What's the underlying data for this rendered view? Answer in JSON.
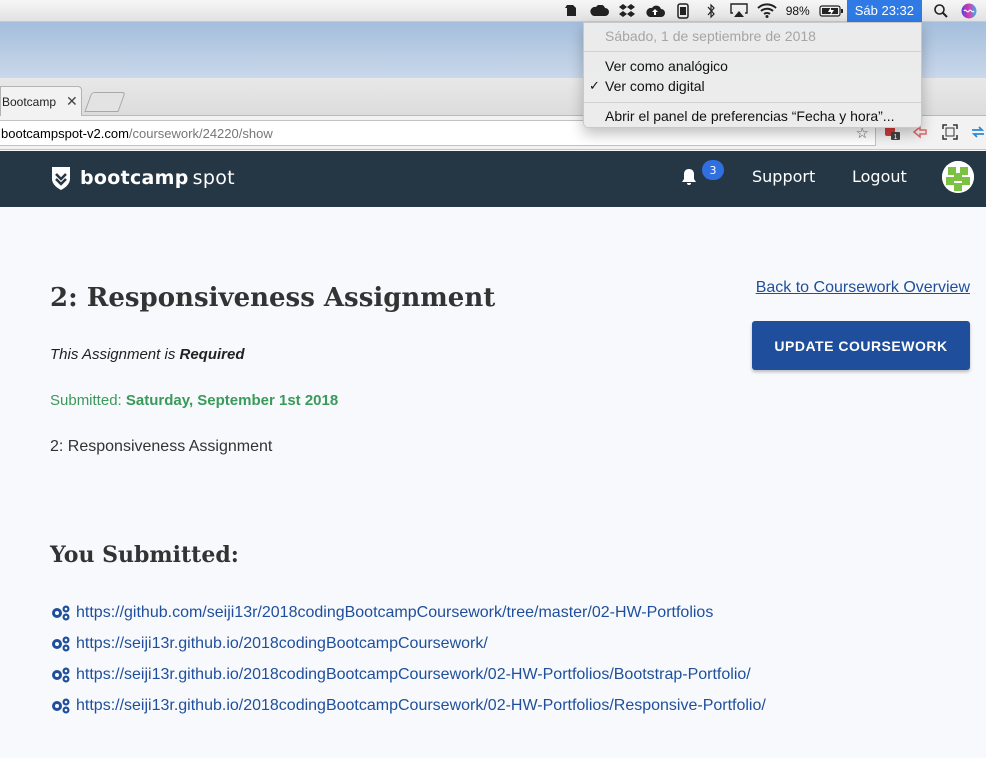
{
  "menubar": {
    "battery": "98%",
    "clock": "Sáb 23:32",
    "icons": [
      "evernote-icon",
      "cloud-icon",
      "dropbox-icon",
      "cloud-upload-icon",
      "phone-icon",
      "bluetooth-icon",
      "airplay-icon",
      "wifi-icon",
      "battery-icon",
      "spotlight-icon",
      "siri-icon"
    ]
  },
  "clock_menu": {
    "date": "Sábado, 1 de septiembre de 2018",
    "analog": "Ver como analógico",
    "digital": "Ver como digital",
    "check": "✓",
    "prefs": "Abrir el panel de preferencias “Fecha y hora”..."
  },
  "browser": {
    "tab_title": "Bootcamp",
    "tab_close": "✕",
    "url_host": "bootcampspot-v2.com",
    "url_path": "/coursework/24220/show",
    "star": "☆",
    "ext_badge": "1"
  },
  "site": {
    "logo_bold": "bootcamp",
    "logo_light": "spot",
    "notifications": "3",
    "support": "Support",
    "logout": "Logout"
  },
  "page": {
    "title": "2: Responsiveness Assignment",
    "required_prefix": "This Assignment is ",
    "required_value": "Required",
    "submitted_label": "Submitted: ",
    "submitted_date": "Saturday, September 1st 2018",
    "description": "2: Responsiveness Assignment",
    "back_link": "Back to Coursework Overview",
    "update_button": "UPDATE COURSEWORK",
    "you_submitted": "You Submitted:",
    "links": [
      "https://github.com/seiji13r/2018codingBootcampCoursework/tree/master/02-HW-Portfolios",
      "https://seiji13r.github.io/2018codingBootcampCoursework/",
      "https://seiji13r.github.io/2018codingBootcampCoursework/02-HW-Portfolios/Bootstrap-Portfolio/",
      "https://seiji13r.github.io/2018codingBootcampCoursework/02-HW-Portfolios/Responsive-Portfolio/"
    ]
  },
  "colors": {
    "header_bg": "#253645",
    "accent": "#1f4f9c",
    "submitted_green": "#3a9a5a",
    "clock_highlight": "#2f7ae5"
  }
}
